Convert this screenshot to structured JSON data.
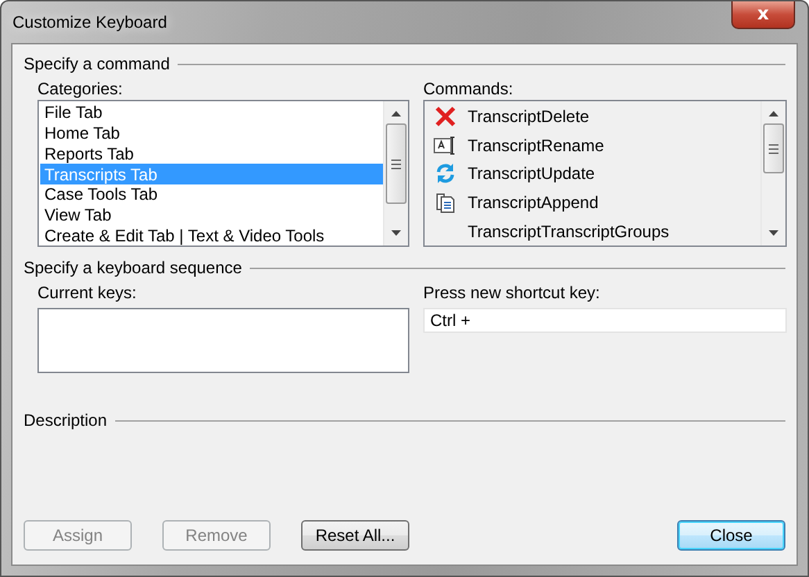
{
  "window": {
    "title": "Customize Keyboard",
    "close_label": "x"
  },
  "command_section": {
    "heading": "Specify a command",
    "categories": {
      "label": "Categories:",
      "items": [
        {
          "label": "File Tab",
          "selected": false
        },
        {
          "label": "Home Tab",
          "selected": false
        },
        {
          "label": "Reports Tab",
          "selected": false
        },
        {
          "label": "Transcripts Tab",
          "selected": true
        },
        {
          "label": "Case Tools Tab",
          "selected": false
        },
        {
          "label": "View Tab",
          "selected": false
        },
        {
          "label": "Create & Edit Tab | Text & Video Tools",
          "selected": false
        }
      ]
    },
    "commands": {
      "label": "Commands:",
      "items": [
        {
          "label": "TranscriptDelete",
          "selected": false
        },
        {
          "label": "TranscriptRename",
          "selected": false
        },
        {
          "label": "TranscriptUpdate",
          "selected": false
        },
        {
          "label": "TranscriptAppend",
          "selected": false
        },
        {
          "label": "TranscriptTranscriptGroups",
          "selected": false
        }
      ]
    }
  },
  "keyboard_section": {
    "heading": "Specify a keyboard sequence",
    "current_keys": {
      "label": "Current keys:"
    },
    "new_key": {
      "label": "Press new shortcut key:",
      "value": "Ctrl +"
    }
  },
  "description_section": {
    "heading": "Description"
  },
  "buttons": [
    {
      "label": "Assign",
      "disabled": true,
      "default": false
    },
    {
      "label": "Remove",
      "disabled": true,
      "default": false
    },
    {
      "label": "Reset All...",
      "disabled": false,
      "default": false
    },
    {
      "label": "Close",
      "disabled": false,
      "default": true
    }
  ]
}
